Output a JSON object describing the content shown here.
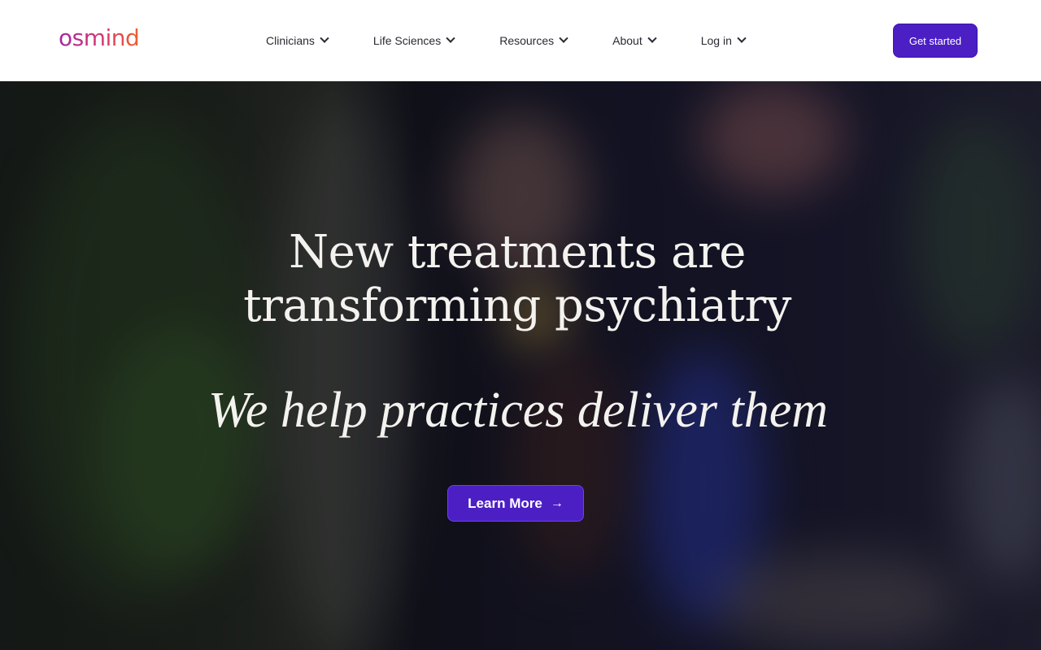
{
  "brand": {
    "name": "osmind"
  },
  "nav": {
    "items": [
      {
        "label": "Clinicians",
        "icon": "chevron-down-icon"
      },
      {
        "label": "Life Sciences",
        "icon": "chevron-down-icon"
      },
      {
        "label": "Resources",
        "icon": "chevron-down-icon"
      },
      {
        "label": "About",
        "icon": "chevron-down-icon"
      },
      {
        "label": "Log in",
        "icon": "chevron-down-icon"
      }
    ],
    "cta_label": "Get started"
  },
  "hero": {
    "title_line1": "New treatments are",
    "title_line2": "transforming psychiatry",
    "subtitle": "We help practices deliver them",
    "button_label": "Learn More",
    "button_icon": "arrow-right-icon"
  },
  "colors": {
    "accent": "#4b1fc4",
    "logo_gradient": [
      "#a2279e",
      "#d63a72",
      "#f0602c"
    ],
    "header_bg": "#ffffff",
    "hero_text": "#f4f2ee"
  }
}
